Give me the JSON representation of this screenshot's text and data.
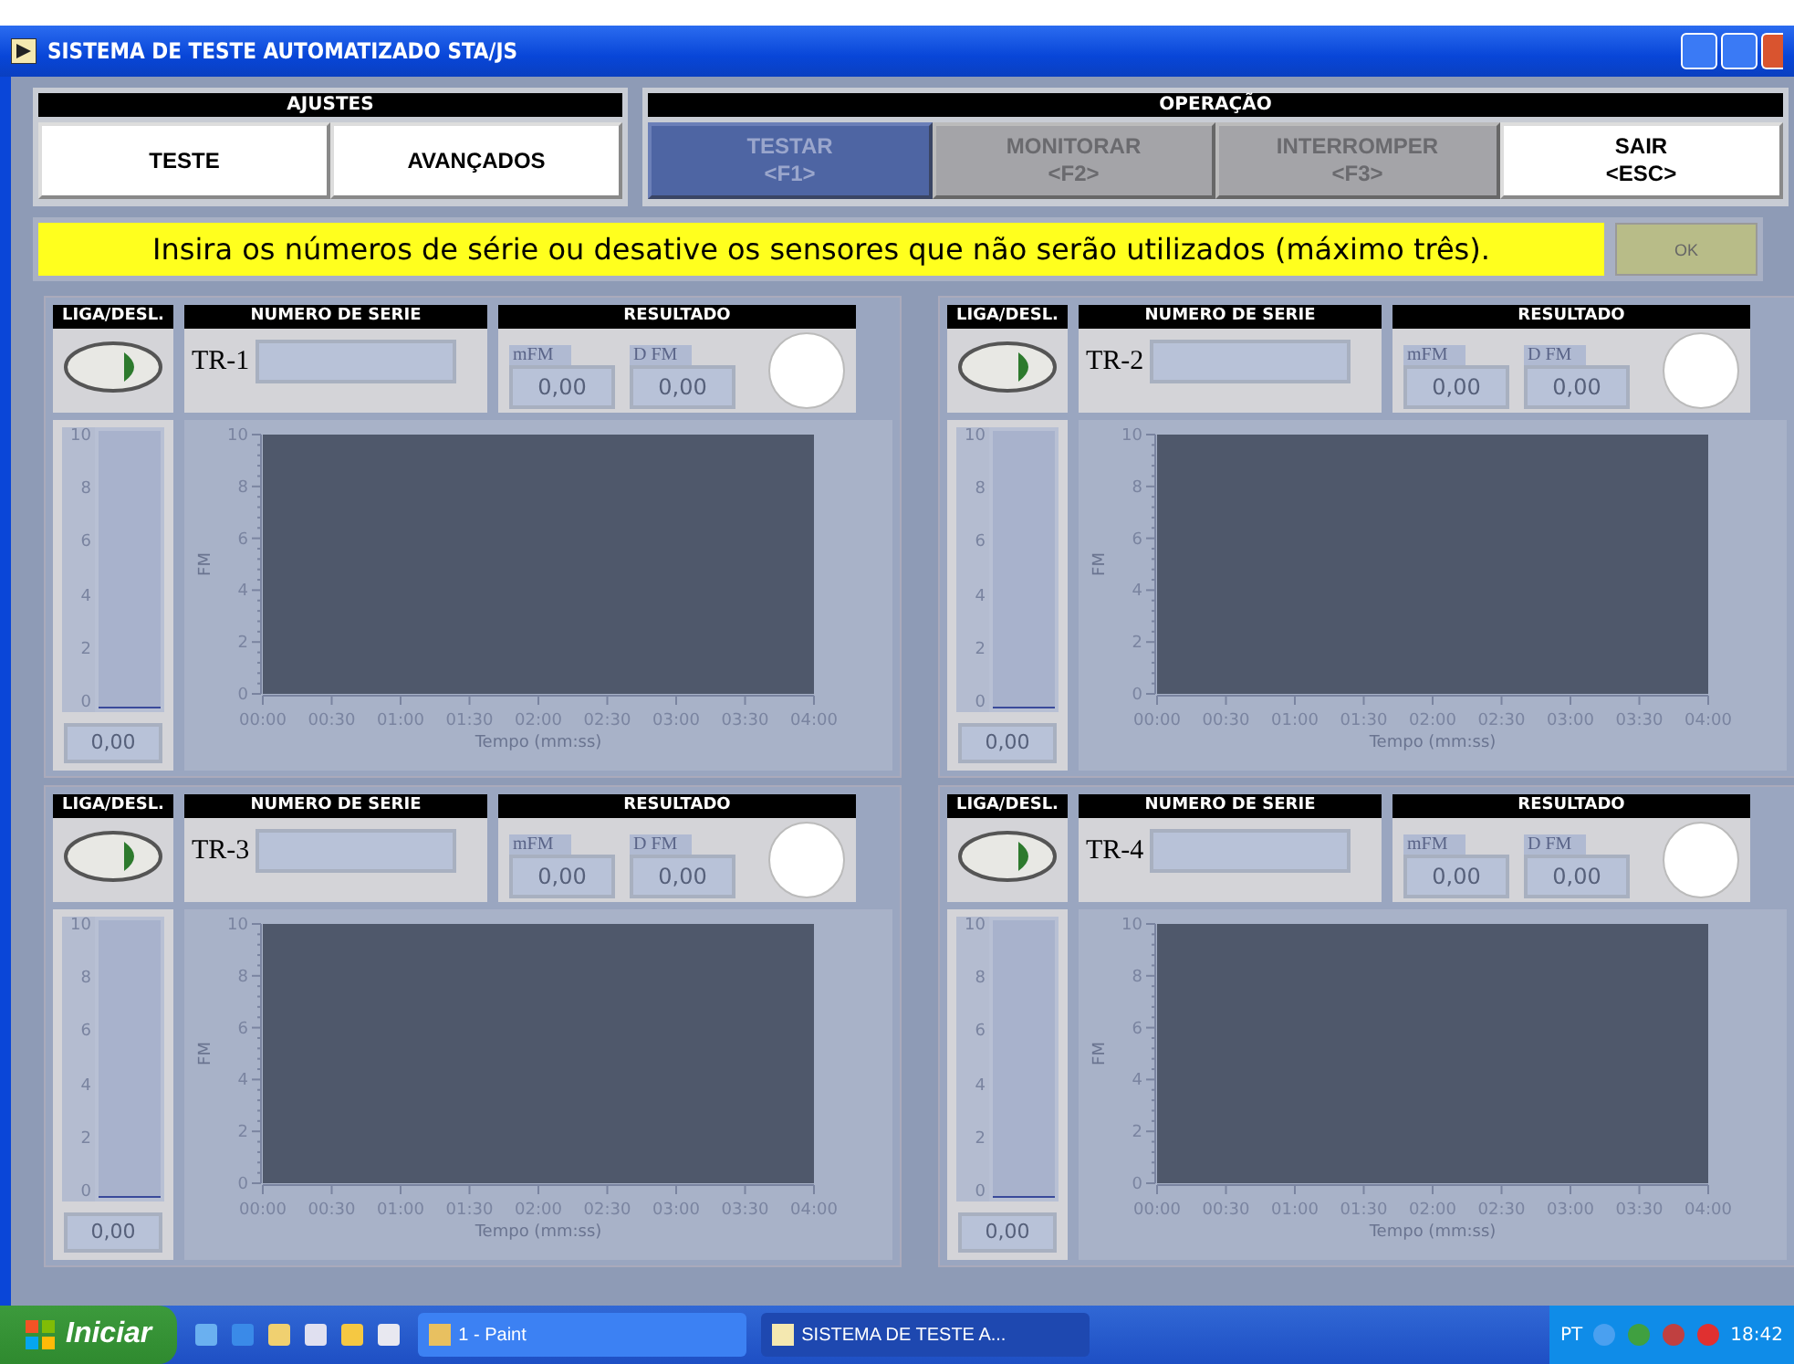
{
  "window": {
    "title": "SISTEMA DE TESTE AUTOMATIZADO STA/JS"
  },
  "ajustes": {
    "title": "AJUSTES",
    "buttons": [
      {
        "label": "TESTE"
      },
      {
        "label": "AVANÇADOS"
      }
    ]
  },
  "operacao": {
    "title": "OPERAÇÃO",
    "buttons": [
      {
        "label": "TESTAR",
        "key": "<F1>",
        "kind": "active"
      },
      {
        "label": "MONITORAR",
        "key": "<F2>",
        "kind": "disabled"
      },
      {
        "label": "INTERROMPER",
        "key": "<F3>",
        "kind": "disabled"
      },
      {
        "label": "SAIR",
        "key": "<ESC>",
        "kind": "normal"
      }
    ]
  },
  "message": {
    "text": "Insira os números de série ou desative os sensores que não serão utilizados (máximo três).",
    "button": "OK"
  },
  "sensors": [
    {
      "switch_title": "LIGA/DESL.",
      "serial_title": "NUMERO DE SERIE",
      "result_title": "RESULTADO",
      "name": "TR-1",
      "on": true,
      "mfm_label": "mFM",
      "mfm": "0,00",
      "dfm_label": "D FM",
      "dfm": "0,00",
      "meter": {
        "scale": [
          "10",
          "8",
          "6",
          "4",
          "2",
          "0"
        ],
        "level": 0,
        "reading": "0,00"
      },
      "chart_data": {
        "type": "line",
        "xlabel": "Tempo (mm:ss)",
        "ylabel": "FM",
        "xlim": [
          0,
          240
        ],
        "ylim": [
          0,
          10
        ],
        "xticks": [
          {
            "value": 0,
            "label": "00:00"
          },
          {
            "value": 30,
            "label": "00:30"
          },
          {
            "value": 60,
            "label": "01:00"
          },
          {
            "value": 90,
            "label": "01:30"
          },
          {
            "value": 120,
            "label": "02:00"
          },
          {
            "value": 150,
            "label": "02:30"
          },
          {
            "value": 180,
            "label": "03:00"
          },
          {
            "value": 210,
            "label": "03:30"
          },
          {
            "value": 240,
            "label": "04:00"
          }
        ],
        "yticks": [
          0,
          2,
          4,
          6,
          8,
          10
        ]
      }
    },
    {
      "switch_title": "LIGA/DESL.",
      "serial_title": "NUMERO DE SERIE",
      "result_title": "RESULTADO",
      "name": "TR-2",
      "on": true,
      "mfm_label": "mFM",
      "mfm": "0,00",
      "dfm_label": "D FM",
      "dfm": "0,00",
      "meter": {
        "scale": [
          "10",
          "8",
          "6",
          "4",
          "2",
          "0"
        ],
        "level": 0,
        "reading": "0,00"
      },
      "chart_data": {
        "type": "line",
        "xlabel": "Tempo (mm:ss)",
        "ylabel": "FM",
        "xlim": [
          0,
          240
        ],
        "ylim": [
          0,
          10
        ],
        "xticks": [
          {
            "value": 0,
            "label": "00:00"
          },
          {
            "value": 30,
            "label": "00:30"
          },
          {
            "value": 60,
            "label": "01:00"
          },
          {
            "value": 90,
            "label": "01:30"
          },
          {
            "value": 120,
            "label": "02:00"
          },
          {
            "value": 150,
            "label": "02:30"
          },
          {
            "value": 180,
            "label": "03:00"
          },
          {
            "value": 210,
            "label": "03:30"
          },
          {
            "value": 240,
            "label": "04:00"
          }
        ],
        "yticks": [
          0,
          2,
          4,
          6,
          8,
          10
        ]
      }
    },
    {
      "switch_title": "LIGA/DESL.",
      "serial_title": "NUMERO DE SERIE",
      "result_title": "RESULTADO",
      "name": "TR-3",
      "on": true,
      "mfm_label": "mFM",
      "mfm": "0,00",
      "dfm_label": "D FM",
      "dfm": "0,00",
      "meter": {
        "scale": [
          "10",
          "8",
          "6",
          "4",
          "2",
          "0"
        ],
        "level": 0,
        "reading": "0,00"
      },
      "chart_data": {
        "type": "line",
        "xlabel": "Tempo (mm:ss)",
        "ylabel": "FM",
        "xlim": [
          0,
          240
        ],
        "ylim": [
          0,
          10
        ],
        "xticks": [
          {
            "value": 0,
            "label": "00:00"
          },
          {
            "value": 30,
            "label": "00:30"
          },
          {
            "value": 60,
            "label": "01:00"
          },
          {
            "value": 90,
            "label": "01:30"
          },
          {
            "value": 120,
            "label": "02:00"
          },
          {
            "value": 150,
            "label": "02:30"
          },
          {
            "value": 180,
            "label": "03:00"
          },
          {
            "value": 210,
            "label": "03:30"
          },
          {
            "value": 240,
            "label": "04:00"
          }
        ],
        "yticks": [
          0,
          2,
          4,
          6,
          8,
          10
        ]
      }
    },
    {
      "switch_title": "LIGA/DESL.",
      "serial_title": "NUMERO DE SERIE",
      "result_title": "RESULTADO",
      "name": "TR-4",
      "on": true,
      "mfm_label": "mFM",
      "mfm": "0,00",
      "dfm_label": "D FM",
      "dfm": "0,00",
      "meter": {
        "scale": [
          "10",
          "8",
          "6",
          "4",
          "2",
          "0"
        ],
        "level": 0,
        "reading": "0,00"
      },
      "chart_data": {
        "type": "line",
        "xlabel": "Tempo (mm:ss)",
        "ylabel": "FM",
        "xlim": [
          0,
          240
        ],
        "ylim": [
          0,
          10
        ],
        "xticks": [
          {
            "value": 0,
            "label": "00:00"
          },
          {
            "value": 30,
            "label": "00:30"
          },
          {
            "value": 60,
            "label": "01:00"
          },
          {
            "value": 90,
            "label": "01:30"
          },
          {
            "value": 120,
            "label": "02:00"
          },
          {
            "value": 150,
            "label": "02:30"
          },
          {
            "value": 180,
            "label": "03:00"
          },
          {
            "value": 210,
            "label": "03:30"
          },
          {
            "value": 240,
            "label": "04:00"
          }
        ],
        "yticks": [
          0,
          2,
          4,
          6,
          8,
          10
        ]
      }
    }
  ],
  "taskbar": {
    "start": "Iniciar",
    "tasks": [
      {
        "label": "1 - Paint",
        "selected": false
      },
      {
        "label": "SISTEMA DE TESTE A...",
        "selected": true
      }
    ],
    "language": "PT",
    "clock": "18:42"
  }
}
